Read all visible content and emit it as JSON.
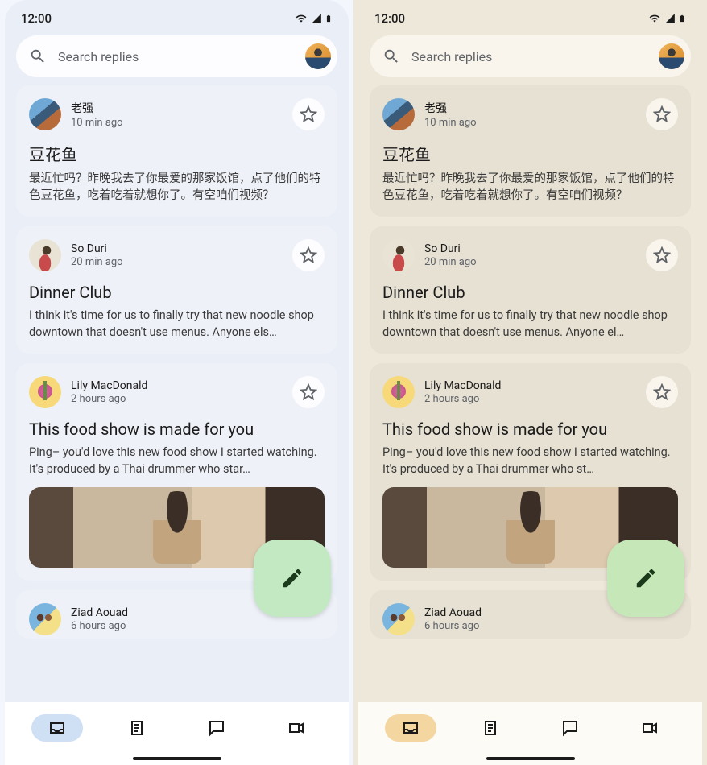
{
  "status": {
    "time": "12:00"
  },
  "search": {
    "placeholder": "Search replies"
  },
  "fab_icon": "edit-icon",
  "posts": [
    {
      "author": "老强",
      "time": "10 min ago",
      "title": "豆花鱼",
      "body": "最近忙吗？昨晚我去了你最爱的那家饭馆，点了他们的特色豆花鱼，吃着吃着就想你了。有空咱们视频？"
    },
    {
      "author": "So Duri",
      "time": "20 min ago",
      "title": "Dinner Club",
      "body_left": "I think it's time for us to finally try that new noodle shop downtown that doesn't use menus. Anyone els…",
      "body_right": "I think it's time for us to finally try that new noodle shop downtown that doesn't use menus. Anyone el…"
    },
    {
      "author": "Lily MacDonald",
      "time": "2 hours ago",
      "title": "This food show is made for you",
      "body_left": "Ping– you'd love this new food show I started watching. It's produced by a Thai drummer who star…",
      "body_right": "Ping– you'd love this new food show I started watching. It's produced by a Thai drummer who st…",
      "media": true
    },
    {
      "author": "Ziad Aouad",
      "time": "6 hours ago"
    }
  ],
  "nav": {
    "items": [
      "inbox",
      "articles",
      "chat",
      "video"
    ],
    "active_index": 0
  }
}
